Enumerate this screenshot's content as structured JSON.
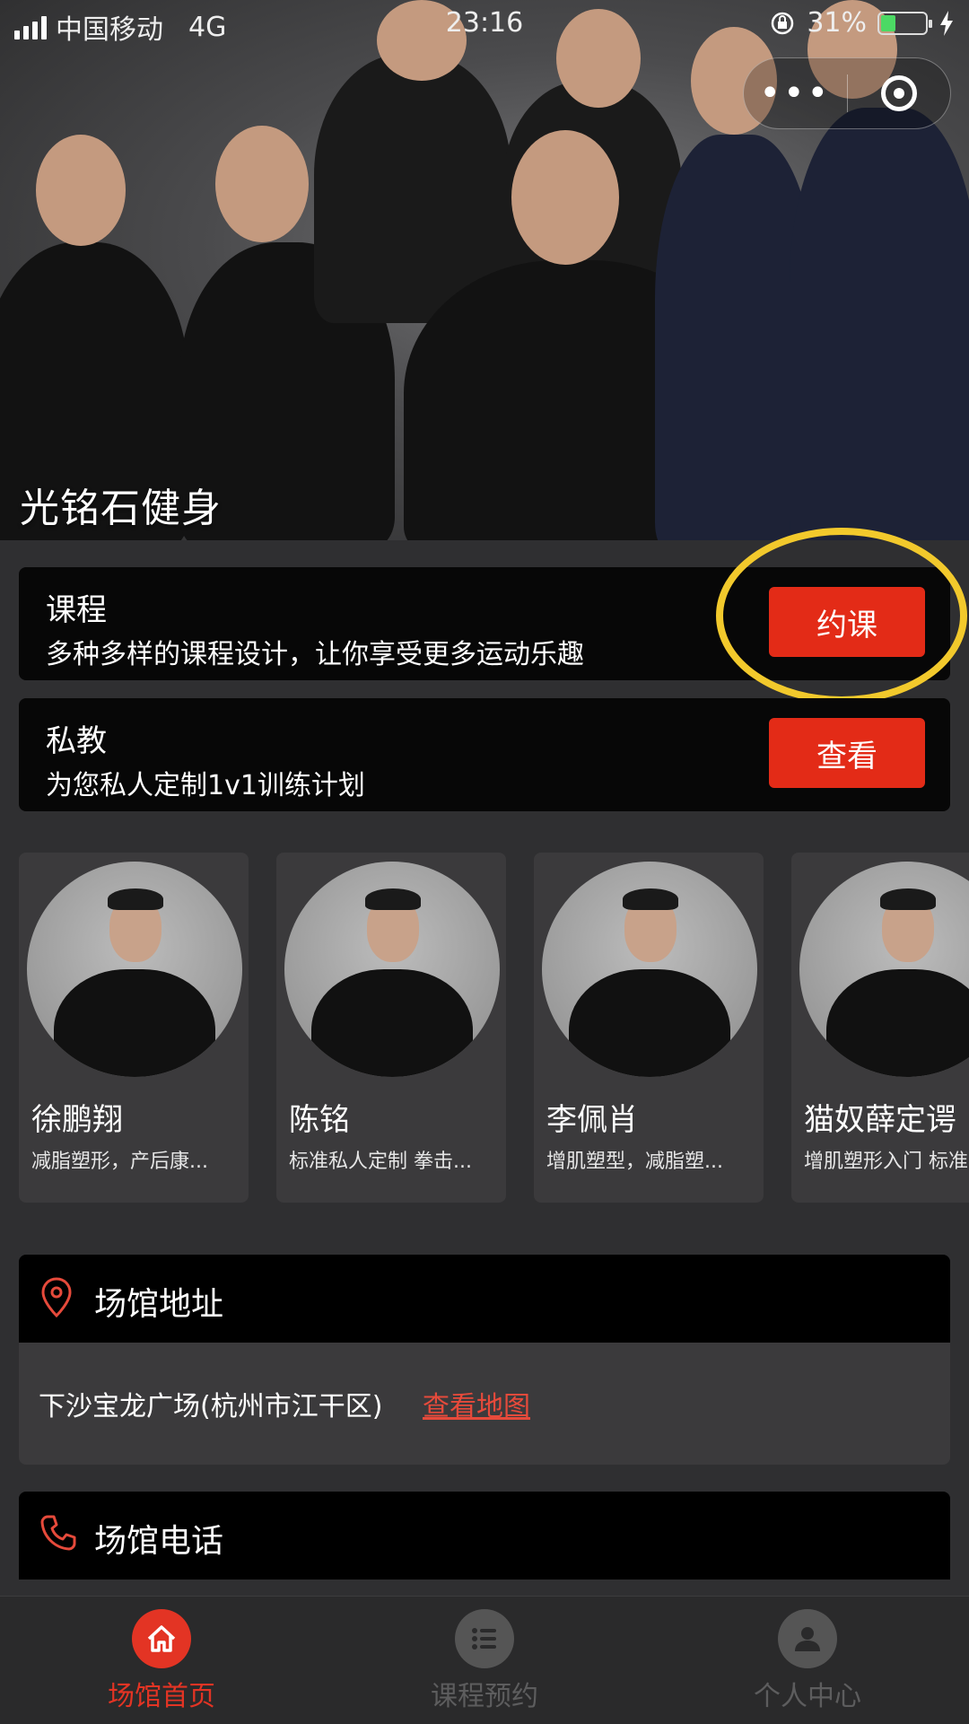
{
  "status_bar": {
    "carrier": "中国移动",
    "network": "4G",
    "time": "23:16",
    "battery": "31%"
  },
  "hero": {
    "title": "光铭石健身"
  },
  "capsule": {
    "more": "•••"
  },
  "cards": [
    {
      "title": "课程",
      "desc": "多种多样的课程设计，让你享受更多运动乐趣",
      "button": "约课"
    },
    {
      "title": "私教",
      "desc": "为您私人定制1v1训练计划",
      "button": "查看"
    }
  ],
  "coaches": [
    {
      "name": "徐鹏翔",
      "tags": "减脂塑形，产后康..."
    },
    {
      "name": "陈铭",
      "tags": "标准私人定制 拳击..."
    },
    {
      "name": "李佩肖",
      "tags": "增肌塑型，减脂塑..."
    },
    {
      "name": "猫奴薛定谔",
      "tags": "增肌塑形入门 标准"
    }
  ],
  "venue": {
    "address_title": "场馆地址",
    "address": "下沙宝龙广场(杭州市江干区)",
    "map_link": "查看地图",
    "phone_title": "场馆电话"
  },
  "tabbar": [
    {
      "label": "场馆首页",
      "active": true
    },
    {
      "label": "课程预约",
      "active": false
    },
    {
      "label": "个人中心",
      "active": false
    }
  ],
  "colors": {
    "accent": "#e32b17",
    "highlight": "#f2c92c",
    "background": "#2f2f31"
  }
}
